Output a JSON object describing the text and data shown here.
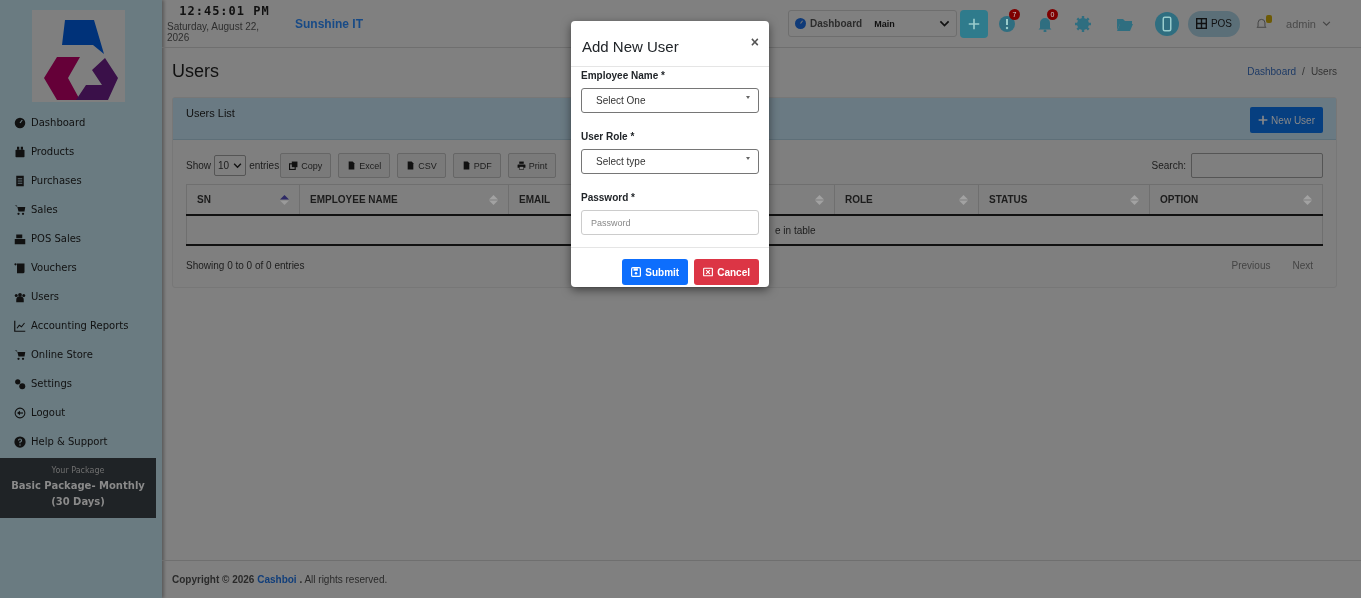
{
  "clock": {
    "time": "12:45:01 PM",
    "date": "Saturday, August 22, 2026"
  },
  "company": "Sunshine IT",
  "topbar": {
    "dashboard_label": "Dashboard",
    "branch": "Main",
    "alerts_badge": "7",
    "notifications_badge": "0",
    "pos_label": "POS",
    "user": "admin"
  },
  "sidebar": {
    "items": [
      {
        "label": "Dashboard"
      },
      {
        "label": "Products"
      },
      {
        "label": "Purchases"
      },
      {
        "label": "Sales"
      },
      {
        "label": "POS Sales"
      },
      {
        "label": "Vouchers"
      },
      {
        "label": "Users"
      },
      {
        "label": "Accounting Reports"
      },
      {
        "label": "Online Store"
      },
      {
        "label": "Settings"
      },
      {
        "label": "Logout"
      },
      {
        "label": "Help & Support"
      }
    ],
    "package": {
      "caption": "Your Package",
      "name": "Basic Package- Monthly (30 Days)"
    }
  },
  "page": {
    "title": "Users",
    "breadcrumb": [
      "Dashboard",
      "Users"
    ],
    "breadcrumb_separator": "/"
  },
  "card": {
    "title": "Users List",
    "new_button": "New User",
    "show_label": "Show",
    "page_size": "10",
    "entries_label": "entries",
    "export_buttons": [
      "Copy",
      "Excel",
      "CSV",
      "PDF",
      "Print"
    ],
    "search_label": "Search:",
    "columns": [
      {
        "label": "SN",
        "sorted": true
      },
      {
        "label": "EMPLOYEE NAME",
        "sorted": false
      },
      {
        "label": "EMAIL"
      },
      {
        "sorted": false
      },
      {
        "label": "ROLE",
        "sorted": false
      },
      {
        "label": "STATUS",
        "sorted": false
      },
      {
        "label": "OPTION",
        "sorted": false
      }
    ],
    "empty_message": "e in table",
    "info": "Showing 0 to 0 of 0 entries",
    "pagination": [
      "Previous",
      "Next"
    ]
  },
  "modal": {
    "title": "Add New User",
    "close": "×",
    "fields": [
      {
        "label": "Employee Name *",
        "kind": "select",
        "placeholder": "Select One"
      },
      {
        "label": "User Role *",
        "kind": "select",
        "placeholder": "Select type"
      },
      {
        "label": "Password *",
        "kind": "password",
        "placeholder": "Password"
      }
    ],
    "buttons": [
      {
        "label": "Submit",
        "kind": "primary"
      },
      {
        "label": "Cancel",
        "kind": "danger"
      }
    ]
  },
  "footer": {
    "prefix": "Copyright © 2026",
    "link": "Cashboi",
    "suffix": ". All rights reserved."
  }
}
